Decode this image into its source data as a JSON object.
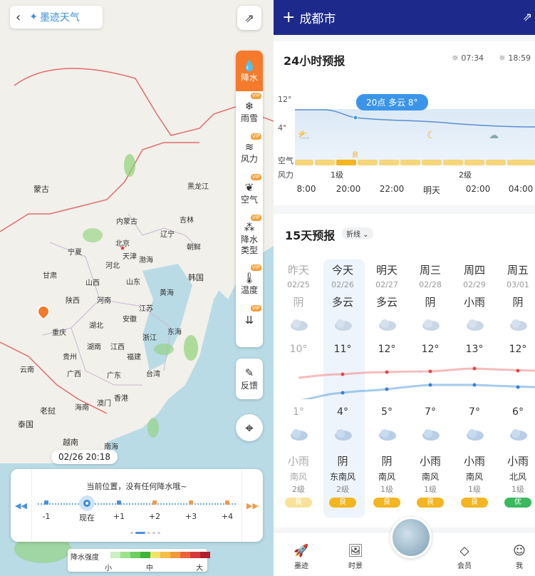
{
  "map": {
    "app_name": "墨迹天气",
    "labels": {
      "mongolia": "蒙古",
      "heilongjiang": "黑龙江",
      "jilin": "吉林",
      "liaoning": "辽宁",
      "beijing": "北京",
      "tianjin": "天津",
      "hebei": "河北",
      "bohai": "渤海",
      "neimenggu": "内蒙古",
      "ningxia": "宁夏",
      "gansu": "甘肃",
      "shanxi": "山西",
      "shaanxi": "陕西",
      "henan": "河南",
      "shandong": "山东",
      "huanghai": "黄海",
      "korea": "韩国",
      "dprk": "朝鲜",
      "chongqing": "重庆",
      "hubei": "湖北",
      "anhui": "安徽",
      "jiangsu": "江苏",
      "zhejiang": "浙江",
      "hunan": "湖南",
      "jiangxi": "江西",
      "fujian": "福建",
      "guizhou": "贵州",
      "guangxi": "广西",
      "guangdong": "广东",
      "yunnan": "云南",
      "taiwan": "台湾",
      "donghai": "东海",
      "hongkong": "香港",
      "macau": "澳门",
      "hainan": "海南",
      "laos": "老挝",
      "thailand": "泰国",
      "vietnam": "越南",
      "nanhai": "南海"
    },
    "tools": [
      {
        "label": "降水",
        "icon": "drops-icon",
        "vip": false,
        "active": true
      },
      {
        "label": "雨雪",
        "icon": "rain-snow-icon",
        "vip": true,
        "active": false
      },
      {
        "label": "风力",
        "icon": "wind-icon",
        "vip": true,
        "active": false
      },
      {
        "label": "空气",
        "icon": "leaf-icon",
        "vip": true,
        "active": false
      },
      {
        "label": "降水类型",
        "icon": "precip-type-icon",
        "vip": true,
        "active": false
      },
      {
        "label": "温度",
        "icon": "thermometer-icon",
        "vip": true,
        "active": false
      },
      {
        "label": "",
        "icon": "temp-more-icon",
        "vip": true,
        "active": false
      }
    ],
    "vip_text": "VIP",
    "feedback_label": "反馈",
    "time_badge": "02/26 20:18",
    "panel": {
      "message": "当前位置，没有任何降水哦~",
      "ticks": [
        "-1",
        "现在",
        "+1",
        "+2",
        "+3",
        "+4"
      ]
    },
    "legend": {
      "title": "降水强度",
      "small": "小",
      "mid": "中",
      "large": "大",
      "colors": [
        "#c8f0c0",
        "#9ee28c",
        "#6fcf5c",
        "#3fb43a",
        "#f2e26a",
        "#f2c04a",
        "#ef9a3a",
        "#e8643a",
        "#d63a3a",
        "#b0202a"
      ]
    }
  },
  "forecast": {
    "city": "成都市",
    "h24": {
      "title": "24小时预报",
      "sunrise": "07:34",
      "sunset": "18:59",
      "y_top": "12°",
      "y_mid": "4°",
      "tooltip": "20点 多云 8°",
      "air_label": "空气",
      "wind_label": "风力",
      "air_good": "良",
      "wind_levels": [
        "1级",
        "2级"
      ],
      "times": [
        "8:00",
        "20:00",
        "22:00",
        "明天",
        "02:00",
        "04:00"
      ]
    },
    "d15": {
      "title": "15天预报",
      "mode": "折线",
      "days": [
        {
          "name": "昨天",
          "date": "02/25",
          "w1": "阴",
          "hi": "10°",
          "lo": "1°",
          "w2": "小雨",
          "wind": "南风",
          "level": "2级",
          "aqi": "良"
        },
        {
          "name": "今天",
          "date": "02/26",
          "w1": "多云",
          "hi": "11°",
          "lo": "4°",
          "w2": "阴",
          "wind": "东南风",
          "level": "2级",
          "aqi": "良"
        },
        {
          "name": "明天",
          "date": "02/27",
          "w1": "多云",
          "hi": "12°",
          "lo": "5°",
          "w2": "阴",
          "wind": "南风",
          "level": "1级",
          "aqi": "良"
        },
        {
          "name": "周三",
          "date": "02/28",
          "w1": "阴",
          "hi": "12°",
          "lo": "7°",
          "w2": "小雨",
          "wind": "南风",
          "level": "1级",
          "aqi": "良"
        },
        {
          "name": "周四",
          "date": "02/29",
          "w1": "小雨",
          "hi": "13°",
          "lo": "7°",
          "w2": "小雨",
          "wind": "南风",
          "level": "1级",
          "aqi": "良"
        },
        {
          "name": "周五",
          "date": "03/01",
          "w1": "阴",
          "hi": "12°",
          "lo": "6°",
          "w2": "小雨",
          "wind": "北风",
          "level": "1级",
          "aqi": "优"
        }
      ]
    },
    "nav": [
      {
        "label": "墨迹",
        "icon": "rocket-icon"
      },
      {
        "label": "时景",
        "icon": "picture-icon"
      },
      {
        "label": "会员",
        "icon": "vip-icon"
      },
      {
        "label": "我",
        "icon": "user-icon"
      }
    ],
    "colors": {
      "brand": "#1d2a8c",
      "accent": "#f57a2b",
      "blue": "#3a95e8",
      "aqi_good": "#f3b520",
      "aqi_excellent": "#3cb95e"
    }
  }
}
